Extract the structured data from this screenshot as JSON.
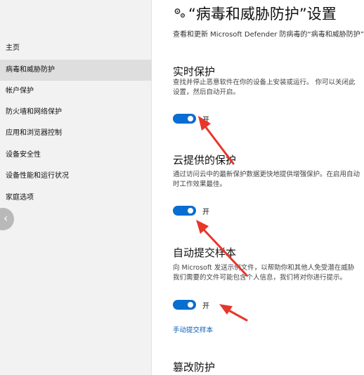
{
  "sidebar": {
    "items": [
      {
        "label": "主页"
      },
      {
        "label": "病毒和威胁防护",
        "selected": true
      },
      {
        "label": "帐户保护"
      },
      {
        "label": "防火墙和网络保护"
      },
      {
        "label": "应用和浏览器控制"
      },
      {
        "label": "设备安全性"
      },
      {
        "label": "设备性能和运行状况"
      },
      {
        "label": "家庭选项"
      }
    ],
    "back_icon": "chevron-left-icon"
  },
  "header": {
    "icon": "gear-icon",
    "title": "“病毒和威胁防护”设置",
    "subtitle": "查看和更新 Microsoft Defender 防病毒的“病毒和威胁防护”设置。"
  },
  "sections": {
    "realtime": {
      "title": "实时保护",
      "desc_line1": "查找并停止恶意软件在你的设备上安装或运行。 你可以关闭此",
      "desc_line2": "设置，然后自动开启。",
      "toggle_state": "on",
      "toggle_label": "开"
    },
    "cloud": {
      "title": "云提供的保护",
      "desc_line1": "通过访问云中的最新保护数据更快地提供增强保护。在启用自动",
      "desc_line2": "时工作效果最佳。",
      "toggle_state": "on",
      "toggle_label": "开"
    },
    "sample": {
      "title": "自动提交样本",
      "desc_line1": "向 Microsoft 发送示例文件，以帮助你和其他人免受潜在威胁",
      "desc_line2": "我们需要的文件可能包含个人信息，我们将对你进行提示。",
      "toggle_state": "on",
      "toggle_label": "开",
      "link": "手动提交样本"
    },
    "tamper": {
      "title": "篡改防护"
    }
  },
  "colors": {
    "accent": "#0a6dd1",
    "link": "#0a5db8",
    "annotation_arrow": "#e8362a",
    "sidebar_bg": "#f2f2f2"
  }
}
